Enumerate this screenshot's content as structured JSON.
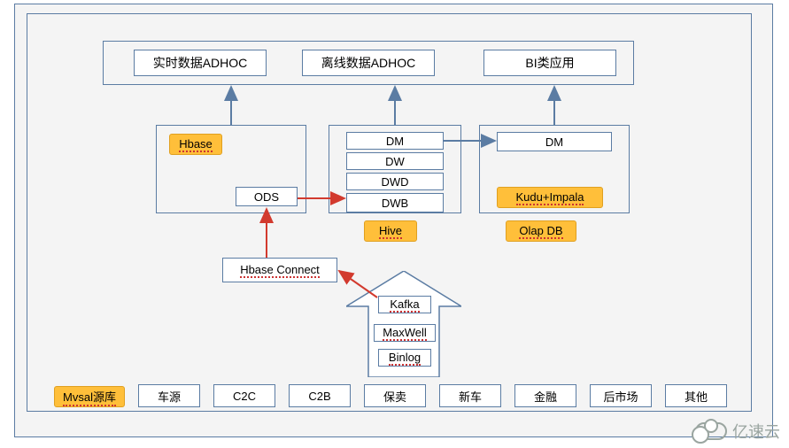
{
  "top": {
    "realtime": "实时数据ADHOC",
    "offline": "离线数据ADHOC",
    "bi": "BI类应用"
  },
  "left_block": {
    "hbase": "Hbase",
    "ods": "ODS"
  },
  "hive_block": {
    "dm": "DM",
    "dw": "DW",
    "dwd": "DWD",
    "dwb": "DWB",
    "label": "Hive"
  },
  "olap_block": {
    "dm": "DM",
    "tech": "Kudu+Impala",
    "label": "Olap DB"
  },
  "connector": {
    "hbase_connect": "Hbase Connect"
  },
  "pipe": {
    "kafka": "Kafka",
    "maxwell": "MaxWell",
    "binlog": "Binlog"
  },
  "sources": {
    "label": "Mvsal源库",
    "items": [
      "车源",
      "C2C",
      "C2B",
      "保卖",
      "新车",
      "金融",
      "后市场",
      "其他"
    ]
  },
  "watermark": "亿速云",
  "colors": {
    "frame": "#5b7ca3",
    "badge": "#ffbf3a",
    "arrow_blue": "#5b7ca3",
    "arrow_red": "#d23a2e"
  }
}
